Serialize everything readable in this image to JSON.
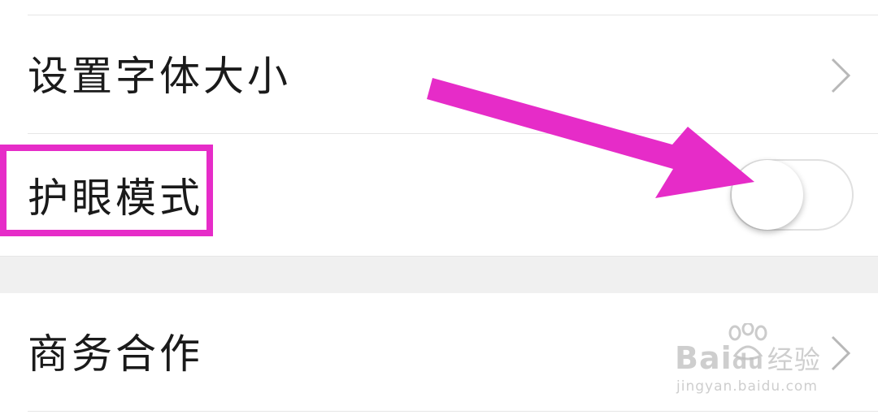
{
  "settings": {
    "items": [
      {
        "label": "设置字体大小",
        "control": "chevron"
      },
      {
        "label": "护眼模式",
        "control": "toggle",
        "toggle_on": false
      },
      {
        "label": "商务合作",
        "control": "chevron"
      }
    ]
  },
  "annotation": {
    "highlight_color": "#e62cc8",
    "arrow_color": "#e62cc8"
  },
  "watermark": {
    "brand": "Bai",
    "brand_suffix": "du",
    "cn": "经验",
    "url": "jingyan.baidu.com"
  }
}
